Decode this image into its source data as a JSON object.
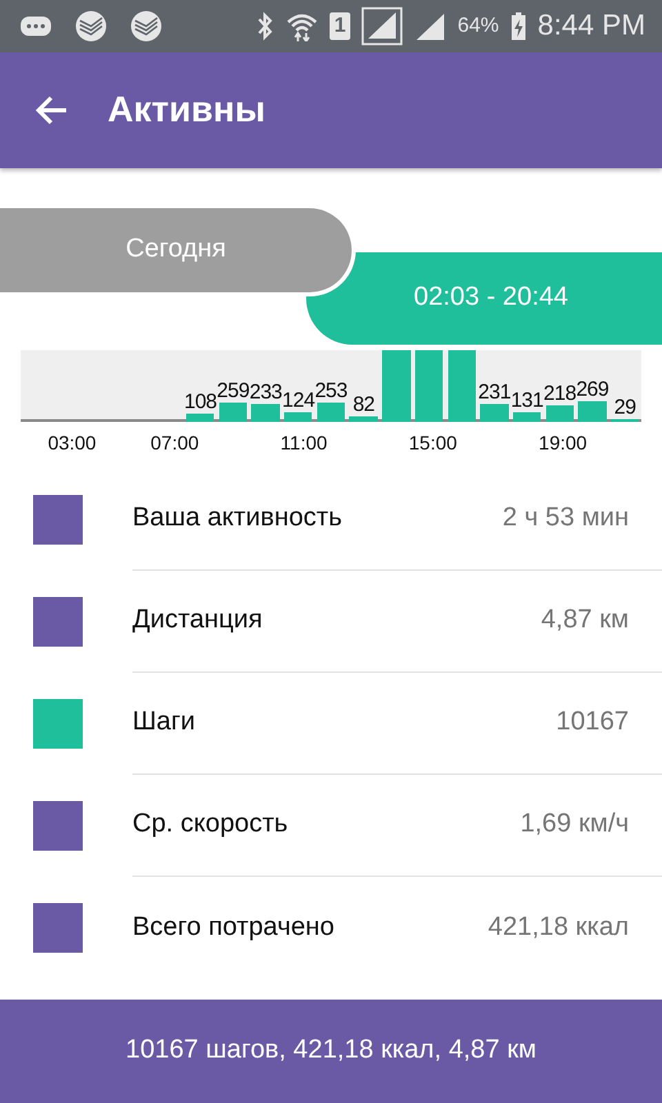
{
  "status_bar": {
    "battery": "64%",
    "time": "8:44 PM",
    "sim": "1"
  },
  "app_bar": {
    "title": "Активны"
  },
  "day_label": "Сегодня",
  "time_range": "02:03 - 20:44",
  "activity_chart": {
    "bars": [
      {
        "kind": "empty"
      },
      {
        "kind": "empty"
      },
      {
        "kind": "empty"
      },
      {
        "kind": "empty"
      },
      {
        "kind": "empty"
      },
      {
        "kind": "value",
        "label": "108"
      },
      {
        "kind": "value",
        "label": "259"
      },
      {
        "kind": "value",
        "label": "233"
      },
      {
        "kind": "value",
        "label": "124"
      },
      {
        "kind": "value",
        "label": "253"
      },
      {
        "kind": "value",
        "label": "82"
      },
      {
        "kind": "overflow"
      },
      {
        "kind": "overflow"
      },
      {
        "kind": "overflow"
      },
      {
        "kind": "value",
        "label": "231"
      },
      {
        "kind": "value",
        "label": "131"
      },
      {
        "kind": "value",
        "label": "218"
      },
      {
        "kind": "value",
        "label": "269"
      },
      {
        "kind": "value",
        "label": "29"
      }
    ],
    "ticks": [
      "03:00",
      "07:00",
      "11:00",
      "15:00",
      "19:00"
    ]
  },
  "stats": [
    {
      "label": "Ваша активность",
      "value": "2 ч 53 мин",
      "color": "#6a5aa6"
    },
    {
      "label": "Дистанция",
      "value": "4,87 км",
      "color": "#6a5aa6"
    },
    {
      "label": "Шаги",
      "value": "10167",
      "color": "#1fbf9b"
    },
    {
      "label": "Ср. скорость",
      "value": "1,69 км/ч",
      "color": "#6a5aa6"
    },
    {
      "label": "Всего потрачено",
      "value": "421,18 ккал",
      "color": "#6a5aa6"
    }
  ],
  "summary": "10167 шагов, 421,18 ккал, 4,87 км"
}
